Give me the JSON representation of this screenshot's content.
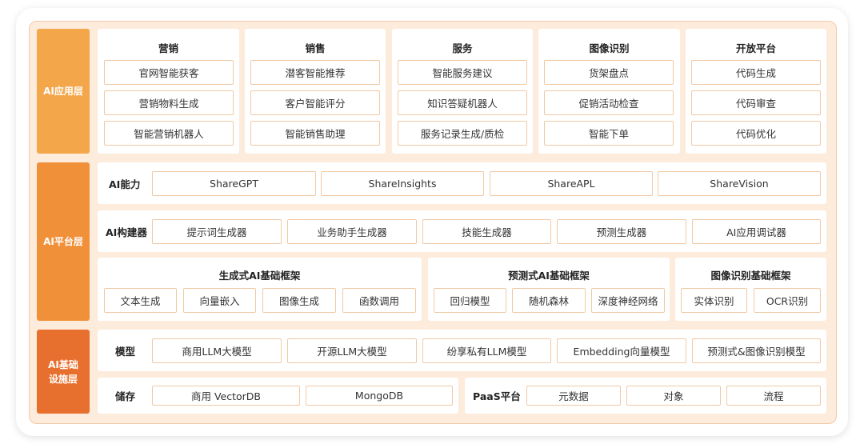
{
  "colors": {
    "app_layer": "#f4a64a",
    "platform_layer": "#f0913a",
    "infra_layer": "#e8702e",
    "frame_bg": "#fdebdc",
    "box_border": "#f0c9a4"
  },
  "layers": {
    "app": "AI应用层",
    "platform": "AI平台层",
    "infra_line1": "AI基础",
    "infra_line2": "设施层"
  },
  "app_columns": [
    {
      "title": "营销",
      "items": [
        "官网智能获客",
        "营销物料生成",
        "智能营销机器人"
      ]
    },
    {
      "title": "销售",
      "items": [
        "潜客智能推荐",
        "客户智能评分",
        "智能销售助理"
      ]
    },
    {
      "title": "服务",
      "items": [
        "智能服务建议",
        "知识答疑机器人",
        "服务记录生成/质检"
      ]
    },
    {
      "title": "图像识别",
      "items": [
        "货架盘点",
        "促销活动检查",
        "智能下单"
      ]
    },
    {
      "title": "开放平台",
      "items": [
        "代码生成",
        "代码审查",
        "代码优化"
      ]
    }
  ],
  "ai_capability": {
    "label": "AI能力",
    "items": [
      "ShareGPT",
      "ShareInsights",
      "ShareAPL",
      "ShareVision"
    ]
  },
  "ai_builder": {
    "label": "AI构建器",
    "items": [
      "提示词生成器",
      "业务助手生成器",
      "技能生成器",
      "预测生成器",
      "AI应用调试器"
    ]
  },
  "frameworks": [
    {
      "title": "生成式AI基础框架",
      "items": [
        "文本生成",
        "向量嵌入",
        "图像生成",
        "函数调用"
      ]
    },
    {
      "title": "预测式AI基础框架",
      "items": [
        "回归模型",
        "随机森林",
        "深度神经网络"
      ]
    },
    {
      "title": "图像识别基础框架",
      "items": [
        "实体识别",
        "OCR识别"
      ]
    }
  ],
  "models": {
    "label": "模型",
    "items": [
      "商用LLM大模型",
      "开源LLM大模型",
      "纷享私有LLM模型",
      "Embedding向量模型",
      "预测式&图像识别模型"
    ]
  },
  "storage": {
    "label": "储存",
    "items": [
      "商用 VectorDB",
      "MongoDB"
    ]
  },
  "paas": {
    "label": "PaaS平台",
    "items": [
      "元数据",
      "对象",
      "流程"
    ]
  }
}
